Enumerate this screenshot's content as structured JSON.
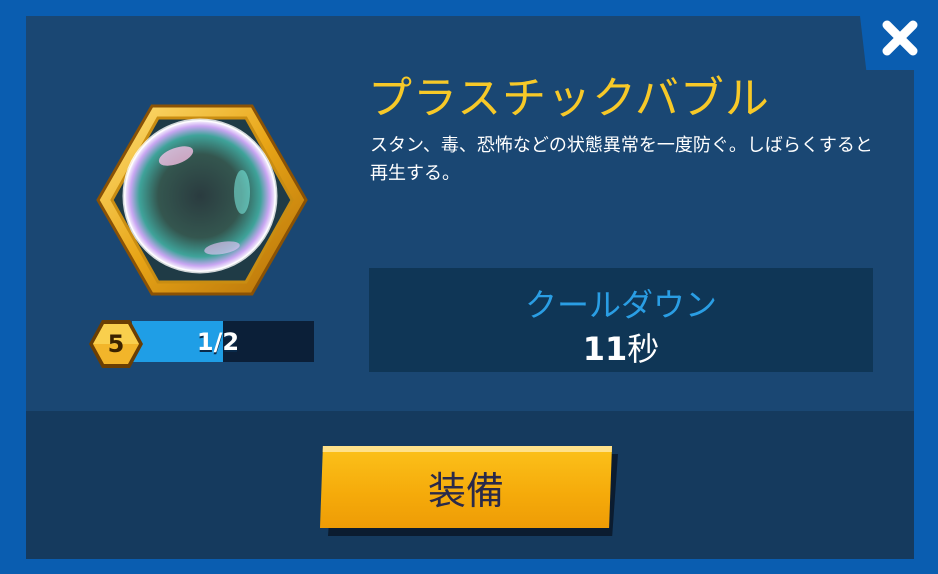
{
  "item": {
    "title": "プラスチックバブル",
    "description": "スタン、毒、恐怖などの状態異常を一度防ぐ。しばらくすると再生する。",
    "level": "5",
    "progress": {
      "text": "1/2",
      "fraction": 0.5
    }
  },
  "cooldown": {
    "label": "クールダウン",
    "value": "11",
    "unit": "秒"
  },
  "actions": {
    "equip_label": "装備"
  },
  "icons": {
    "close": "close-icon",
    "item": "bubble-item-icon",
    "level": "hexagon-level-badge"
  },
  "colors": {
    "background": "#0a5db0",
    "panel": "#1a4773",
    "title": "#f7c928",
    "accent": "#2a9ee4",
    "button": "#f5aa0a"
  }
}
